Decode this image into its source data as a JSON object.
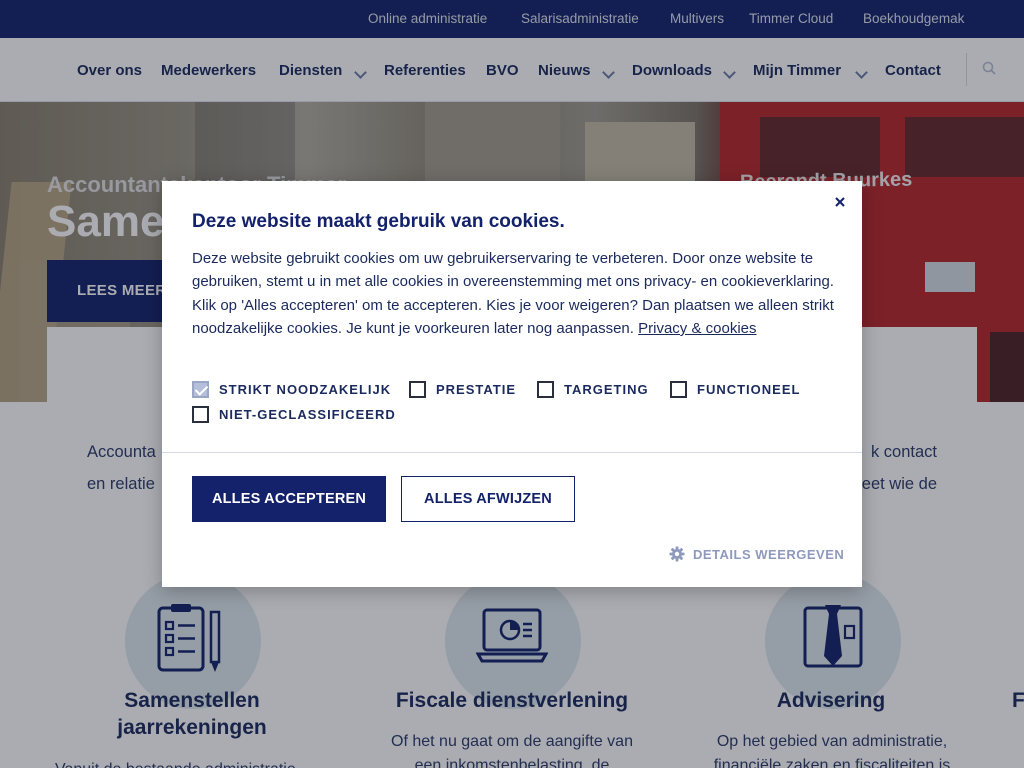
{
  "topbar": {
    "links": [
      "Online administratie",
      "Salarisadministratie",
      "Multivers",
      "Timmer Cloud",
      "Boekhoudgemak"
    ]
  },
  "nav": {
    "items": [
      "Over ons",
      "Medewerkers",
      "Diensten",
      "Referenties",
      "BVO",
      "Nieuws",
      "Downloads",
      "Mijn Timmer",
      "Contact"
    ]
  },
  "hero": {
    "subtitle": "Accountantskantoor Timmer",
    "title": "Samen",
    "button": "LEES MEER",
    "truck_text": "Beerendt Buurkes"
  },
  "intro": {
    "left_lines": [
      "Accounta",
      "en relatie"
    ],
    "right_lines": [
      "k contact",
      "eet wie de"
    ]
  },
  "services": [
    {
      "title": "Samenstellen jaarrekeningen",
      "desc": "Vanuit de bestaande administratie"
    },
    {
      "title": "Fiscale dienstverlening",
      "desc_lines": [
        "Of het nu gaat om de aangifte van",
        "een inkomstenbelasting, de"
      ]
    },
    {
      "title": "Advisering",
      "desc_lines": [
        "Op het gebied van administratie,",
        "financiële zaken en fiscaliteiten is"
      ]
    },
    {
      "title": "F"
    }
  ],
  "cookie_modal": {
    "title": "Deze website maakt gebruik van cookies.",
    "text": "Deze website gebruikt cookies om uw gebruikerservaring te verbeteren. Door onze website te gebruiken, stemt u in met alle cookies in overeenstemming met ons privacy- en cookieverklaring. Klik op 'Alles accepteren' om te accepteren. Kies je voor weigeren? Dan plaatsen we alleen strikt noodzakelijke cookies. Je kunt je voorkeuren later nog aanpassen.",
    "link": "Privacy & cookies",
    "categories": [
      {
        "label": "STRIKT NOODZAKELIJK",
        "checked": true
      },
      {
        "label": "PRESTATIE",
        "checked": false
      },
      {
        "label": "TARGETING",
        "checked": false
      },
      {
        "label": "FUNCTIONEEL",
        "checked": false
      },
      {
        "label": "NIET-GECLASSIFICEERD",
        "checked": false
      }
    ],
    "accept_label": "ALLES ACCEPTEREN",
    "reject_label": "ALLES AFWIJZEN",
    "details_label": "DETAILS WEERGEVEN"
  },
  "colors": {
    "primary": "#13226b",
    "text": "#1b2a5e",
    "icon_circle": "#dfe8ee"
  },
  "icons": [
    "search-icon",
    "chevron-down-icon",
    "close-icon",
    "gear-icon",
    "clipboard-icon",
    "laptop-chart-icon",
    "tie-shirt-icon"
  ]
}
